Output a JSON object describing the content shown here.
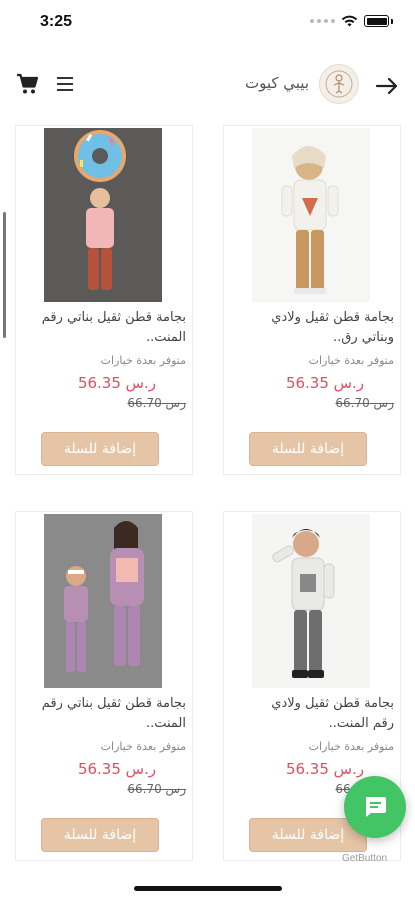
{
  "status_bar": {
    "time": "3:25"
  },
  "header": {
    "brand_name": "بيبي كيوت"
  },
  "products": [
    {
      "title_line1": "بجامة قطن ثقيل ولادي",
      "title_line2": "وبناتي رق..",
      "options_note": "متوفر بعدة خيارات",
      "price": "ر.س 56.35",
      "old_price": "رس 66.70",
      "add_label": "إضافة للسلة"
    },
    {
      "title_line1": "بجامة قطن ثقيل بناتي رقم",
      "title_line2": "المنت..",
      "options_note": "متوفر بعدة خيارات",
      "price": "ر.س 56.35",
      "old_price": "رس 66.70",
      "add_label": "إضافة للسلة"
    },
    {
      "title_line1": "بجامة قطن ثقيل ولادي",
      "title_line2": "رقم المنت..",
      "options_note": "متوفر بعدة خيارات",
      "price": "ر.س 56.35",
      "old_price": "رس 66.70",
      "add_label": "إضافة للسلة"
    },
    {
      "title_line1": "بجامة قطن ثقيل بناتي رقم",
      "title_line2": "المنت..",
      "options_note": "متوفر بعدة خيارات",
      "price": "ر.س 56.35",
      "old_price": "رس 66.70",
      "add_label": "إضافة للسلة"
    }
  ],
  "chat_widget": {
    "provider_label": "GetButton"
  },
  "colors": {
    "price": "#e14f62",
    "button": "#e6c5a6",
    "chat": "#43c465"
  },
  "icons": [
    "back-arrow-icon",
    "brand-logo",
    "cart-icon",
    "menu-icon",
    "chat-icon"
  ]
}
